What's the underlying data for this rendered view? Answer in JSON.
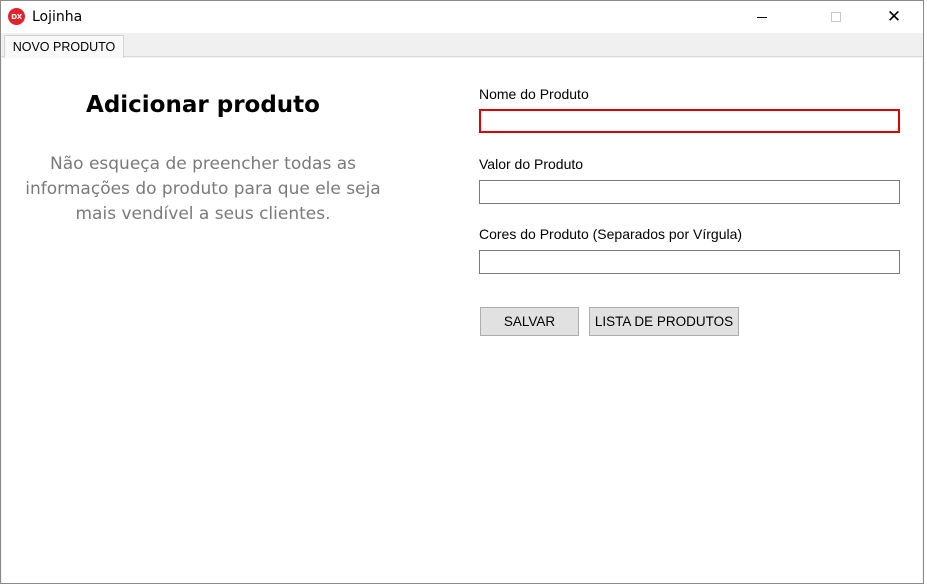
{
  "window": {
    "app_icon_text": "DX",
    "title": "Lojinha",
    "controls": {
      "minimize_icon": "minimize-icon",
      "maximize_icon": "maximize-icon",
      "close_icon": "close-icon",
      "close_glyph": "✕"
    }
  },
  "tabs": [
    {
      "label": "NOVO PRODUTO",
      "active": true
    }
  ],
  "left_panel": {
    "heading": "Adicionar produto",
    "description": "Não esqueça de preencher todas as informações do produto para que ele seja mais vendível a seus clientes."
  },
  "form": {
    "name": {
      "label": "Nome do Produto",
      "value": "",
      "invalid": true
    },
    "price": {
      "label": "Valor do Produto",
      "value": ""
    },
    "colors": {
      "label": "Cores do Produto (Separados por Vírgula)",
      "value": ""
    }
  },
  "buttons": {
    "save": "SALVAR",
    "list": "LISTA DE PRODUTOS"
  },
  "colors": {
    "error_border": "#e00000",
    "description_text": "#7a7a7a",
    "button_bg": "#e1e1e1",
    "app_icon": "#e0242c"
  }
}
